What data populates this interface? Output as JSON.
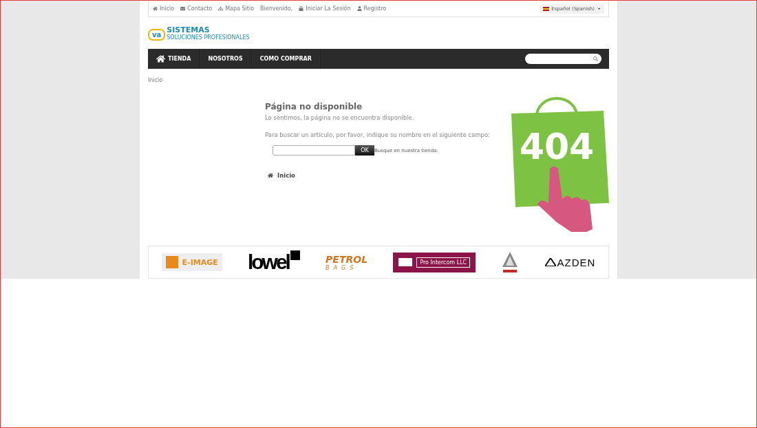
{
  "top_bar": {
    "links": [
      {
        "kind": "home",
        "label": "Inicio"
      },
      {
        "kind": "mail",
        "label": "Contacto"
      },
      {
        "kind": "sitemap",
        "label": "Mapa Sitio"
      },
      {
        "kind": "text",
        "label": "Bienvenido,"
      },
      {
        "kind": "lock",
        "label": "Iniciar La Sesión"
      },
      {
        "kind": "user",
        "label": "Registro"
      }
    ],
    "language": "Español (Spanish)"
  },
  "logo": {
    "mark": "va",
    "name": "SISTEMAS",
    "tagline": "SOLUCIONES PROFESIONALES"
  },
  "nav": [
    {
      "label": "TIENDA",
      "home": true
    },
    {
      "label": "NOSOTROS",
      "home": false
    },
    {
      "label": "COMO COMPRAR",
      "home": false
    }
  ],
  "breadcrumb": "Inicio",
  "error": {
    "title": "Página no disponible",
    "message": "Lo sentimos, la página no se encuentra disponible.",
    "prompt": "Para buscar un artículo, por favor, indique su nombre en el siguiente campo:",
    "button": "OK",
    "search_label": "Busque en nuestra tienda:",
    "home_link": "Inicio",
    "badge": "404"
  },
  "brands": [
    {
      "kind": "eimage",
      "name": "E-IMAGE"
    },
    {
      "kind": "lowel",
      "name": "lowel"
    },
    {
      "kind": "petrol",
      "name": "PETROL",
      "sub": "BAGS"
    },
    {
      "kind": "intercom",
      "name": "Pro Intercom LLC"
    },
    {
      "kind": "emblem"
    },
    {
      "kind": "azden",
      "name": "AZDEN"
    }
  ]
}
